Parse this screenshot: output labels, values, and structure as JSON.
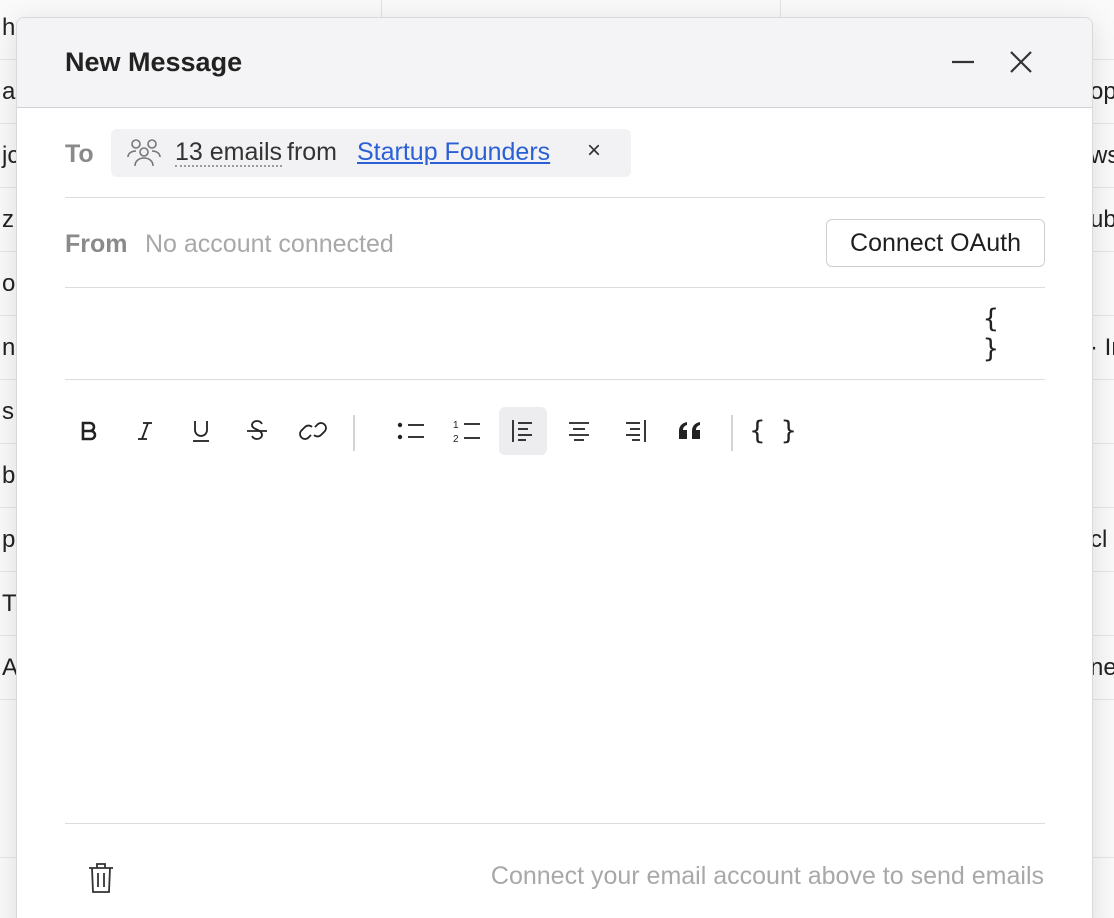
{
  "background": {
    "left_cells": [
      "h",
      "a",
      "jc",
      "z",
      "o",
      "n",
      "s",
      "b",
      "p",
      "T",
      "A"
    ],
    "right_cells": [
      "op",
      "ws",
      "ub",
      "· In",
      "cl",
      "ne"
    ]
  },
  "dialog": {
    "title": "New Message",
    "header_icons": [
      "minimize-icon",
      "close-icon"
    ]
  },
  "to": {
    "label": "To",
    "chip": {
      "icon": "users-group-icon",
      "count_text": "13 emails",
      "from_text": "from",
      "list_name": "Startup Founders",
      "remove_glyph": "×"
    }
  },
  "from": {
    "label": "From",
    "placeholder": "No account connected",
    "connect_label": "Connect OAuth"
  },
  "subject": {
    "value": "",
    "variable_glyph": "{ }"
  },
  "toolbar": {
    "active": "align-left",
    "variable_glyph": "{ }",
    "items": [
      "bold",
      "italic",
      "underline",
      "strikethrough",
      "link",
      "bullet-list",
      "numbered-list",
      "align-left",
      "align-center",
      "align-right",
      "blockquote",
      "variable"
    ]
  },
  "footer": {
    "trash_icon": "trash-icon",
    "hint": "Connect your email account above to send emails"
  },
  "colors": {
    "link": "#2a5fd6",
    "header_bg": "#f4f4f6",
    "muted_text": "#a8a8a8"
  }
}
